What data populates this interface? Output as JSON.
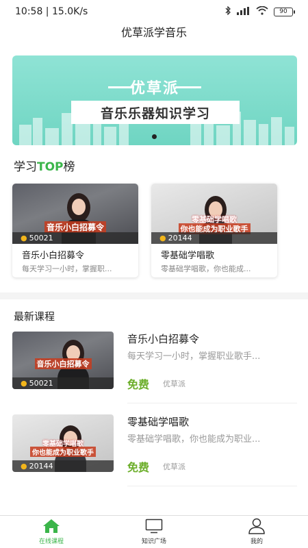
{
  "status_bar": {
    "time_speed": "10:58 | 15.0K/s",
    "battery": "90"
  },
  "app_title": "优草派学音乐",
  "banner": {
    "brand": "优草派",
    "subtitle": "音乐乐器知识学习"
  },
  "top_section": {
    "title_prefix": "学习",
    "title_accent": "TOP",
    "title_suffix": "榜"
  },
  "top_cards": [
    {
      "caption": "音乐小白招募令",
      "views": "50021",
      "title": "音乐小白招募令",
      "subtitle": "每天学习一小时，掌握职..."
    },
    {
      "caption_line1": "零基础学唱歌",
      "caption_line2": "你也能成为职业歌手",
      "views": "20144",
      "title": "零基础学唱歌",
      "subtitle": "零基础学唱歌，你也能成..."
    }
  ],
  "latest_section": {
    "title": "最新课程"
  },
  "courses": [
    {
      "caption": "音乐小白招募令",
      "views": "50021",
      "title": "音乐小白招募令",
      "description": "每天学习一小时，掌握职业歌手...",
      "price": "免费",
      "author": "优草派"
    },
    {
      "caption_line1": "零基础学唱歌",
      "caption_line2": "你也能成为职业歌手",
      "views": "20144",
      "title": "零基础学唱歌",
      "description": "零基础学唱歌，你也能成为职业...",
      "price": "免费",
      "author": "优草派"
    }
  ],
  "bottom_nav": [
    {
      "label": "在线课程",
      "icon": "home-icon",
      "active": true
    },
    {
      "label": "知识广场",
      "icon": "monitor-icon",
      "active": false
    },
    {
      "label": "我的",
      "icon": "user-icon",
      "active": false
    }
  ],
  "colors": {
    "accent_green": "#3bb54a",
    "price_green": "#6cae2a",
    "banner_teal": "#7dddcb"
  }
}
